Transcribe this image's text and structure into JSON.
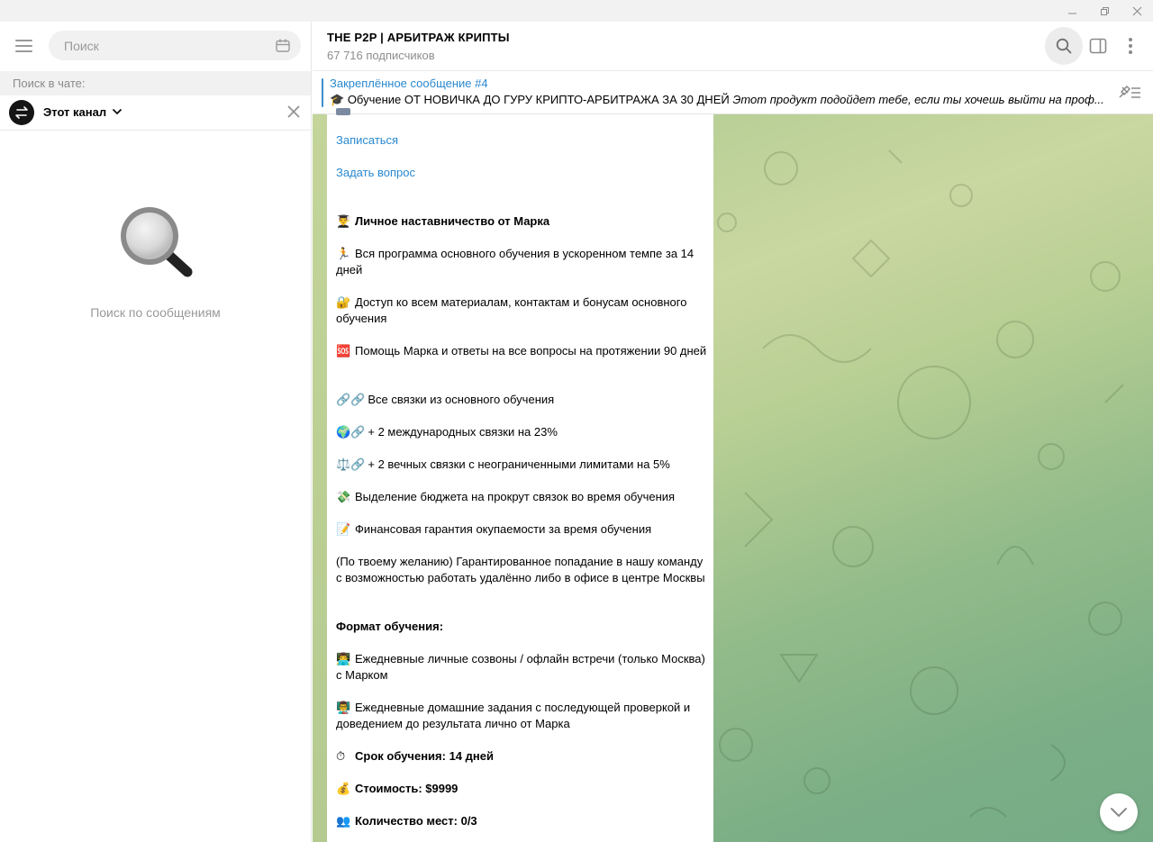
{
  "left": {
    "search_placeholder": "Поиск",
    "search_in_chat_label": "Поиск в чате:",
    "scope_label": "Этот канал",
    "empty_text": "Поиск по сообщениям"
  },
  "chat": {
    "title": "THE P2P | АРБИТРАЖ КРИПТЫ",
    "subscribers": "67 716 подписчиков"
  },
  "pinned": {
    "title": "Закреплённое сообщение #4",
    "emoji": "🎓",
    "text": "Обучение  ОТ НОВИЧКА ДО ГУРУ КРИПТО-АРБИТРАЖА ЗА 30 ДНЕЙ",
    "italic": "Этот продукт подойдет тебе, если ты хочешь выйти на проф..."
  },
  "message": {
    "link_signup": "Записаться",
    "link_ask": "Задать вопрос",
    "heading": "Личное наставничество от Марка",
    "heading_emoji": "👨‍🎓",
    "items": [
      {
        "emoji": "🏃",
        "text": "Вся программа основного обучения в ускоренном темпе за 14 дней"
      },
      {
        "emoji": "🔐",
        "text": "Доступ ко всем материалам, контактам и бонусам основного обучения"
      },
      {
        "emoji": "🆘",
        "text": "Помощь Марка и ответы на все вопросы на протяжении 90 дней"
      },
      {
        "emoji": "🔗🔗",
        "text": "Все связки из основного обучения"
      },
      {
        "emoji": "🌍🔗",
        "text": "+ 2 международных связки на 23%"
      },
      {
        "emoji": "⚖️🔗",
        "text": "+ 2 вечных связки с неограниченными лимитами на 5%"
      },
      {
        "emoji": "💸",
        "text": "Выделение бюджета на прокрут связок во время обучения"
      },
      {
        "emoji": "📝",
        "text": "Финансовая гарантия окупаемости за время обучения"
      }
    ],
    "team_text": "(По твоему желанию) Гарантированное попадание в нашу команду с возможностью работать удалённо либо в офисе в центре Москвы",
    "format_heading": "Формат обучения:",
    "format_items": [
      {
        "emoji": "👨‍💻",
        "text": "Ежедневные личные созвоны / офлайн встречи (только Москва) с Марком"
      },
      {
        "emoji": "👨‍🏫",
        "text": "Ежедневные домашние задания с последующей проверкой и доведением до результата лично от Марка"
      }
    ],
    "duration": {
      "emoji": "⏱",
      "text": "Срок обучения: 14 дней"
    },
    "price": {
      "emoji": "💰",
      "text": "Стоимость: $9999"
    },
    "seats": {
      "emoji": "👥",
      "text": "Количество мест: 0/3"
    }
  }
}
